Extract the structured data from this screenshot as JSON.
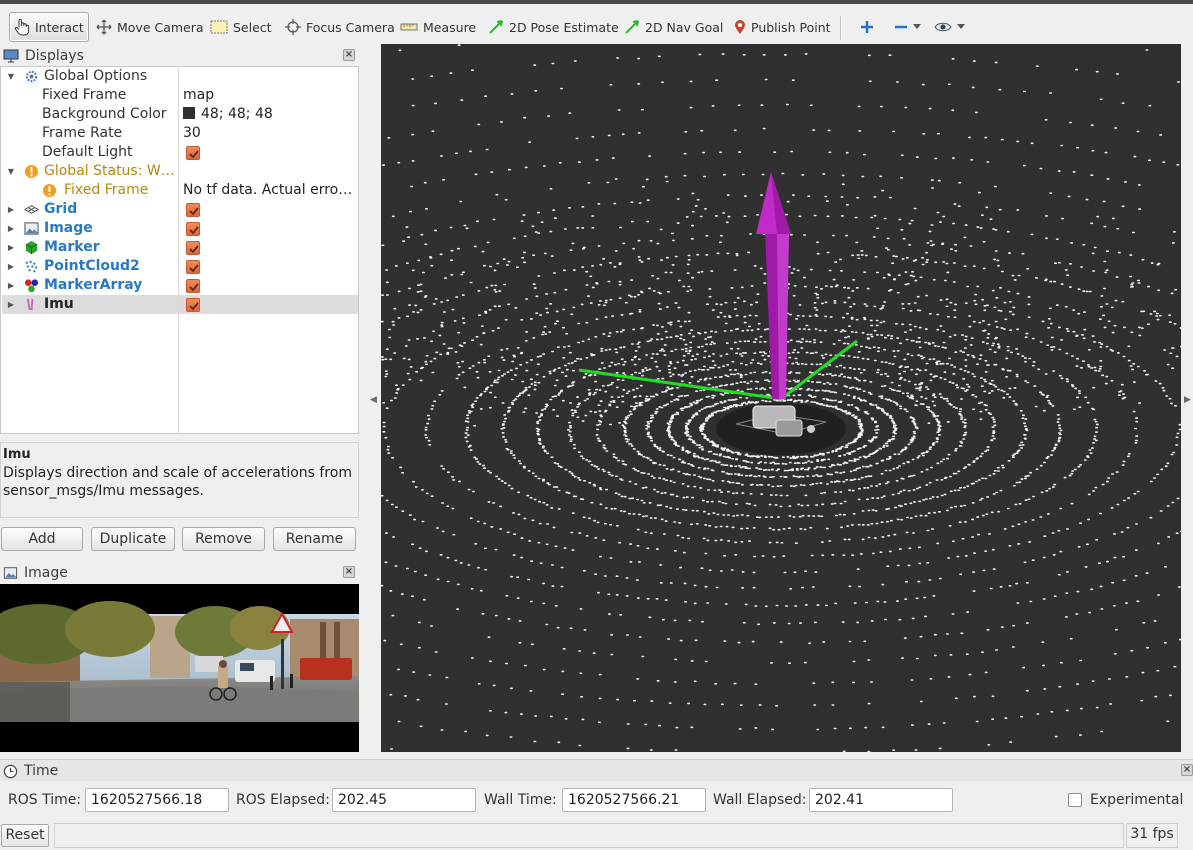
{
  "toolbar": {
    "tools": [
      {
        "label": "Interact",
        "icon": "hand-pointer-icon"
      },
      {
        "label": "Move Camera",
        "icon": "move-arrows-icon"
      },
      {
        "label": "Select",
        "icon": "select-box-icon"
      },
      {
        "label": "Focus Camera",
        "icon": "crosshair-icon"
      },
      {
        "label": "Measure",
        "icon": "ruler-icon"
      },
      {
        "label": "2D Pose Estimate",
        "icon": "green-arrow-icon"
      },
      {
        "label": "2D Nav Goal",
        "icon": "green-arrow-icon"
      },
      {
        "label": "Publish Point",
        "icon": "map-pin-icon"
      }
    ]
  },
  "displays": {
    "title": "Displays",
    "rows": [
      {
        "label": "Global Options",
        "value": ""
      },
      {
        "label": "Fixed Frame",
        "value": "map"
      },
      {
        "label": "Background Color",
        "value": "48; 48; 48"
      },
      {
        "label": "Frame Rate",
        "value": "30"
      },
      {
        "label": "Default Light",
        "value": ""
      },
      {
        "label": "Global Status: W…",
        "value": ""
      },
      {
        "label": "Fixed Frame",
        "value": "No tf data.  Actual erro…"
      },
      {
        "label": "Grid",
        "value": ""
      },
      {
        "label": "Image",
        "value": ""
      },
      {
        "label": "Marker",
        "value": ""
      },
      {
        "label": "PointCloud2",
        "value": ""
      },
      {
        "label": "MarkerArray",
        "value": ""
      },
      {
        "label": "Imu",
        "value": ""
      }
    ],
    "background_color_hex": "#303030"
  },
  "description": {
    "title": "Imu",
    "text": "Displays direction and scale of accelerations from sensor_msgs/Imu messages."
  },
  "buttons": {
    "add": "Add",
    "duplicate": "Duplicate",
    "remove": "Remove",
    "rename": "Rename"
  },
  "image_panel": {
    "title": "Image"
  },
  "time": {
    "title": "Time",
    "ros_time_label": "ROS Time:",
    "ros_time": "1620527566.18",
    "ros_elapsed_label": "ROS Elapsed:",
    "ros_elapsed": "202.45",
    "wall_time_label": "Wall Time:",
    "wall_time": "1620527566.21",
    "wall_elapsed_label": "Wall Elapsed:",
    "wall_elapsed": "202.41",
    "experimental_label": "Experimental"
  },
  "status": {
    "reset_label": "Reset",
    "fps": "31 fps"
  },
  "colors": {
    "view_background": "#303030",
    "checkbox": "#e36f42",
    "label_blue": "#2878c8",
    "warning": "#b8860b",
    "imu_arrow": "#b020b8",
    "axis_green": "#22dd22"
  }
}
